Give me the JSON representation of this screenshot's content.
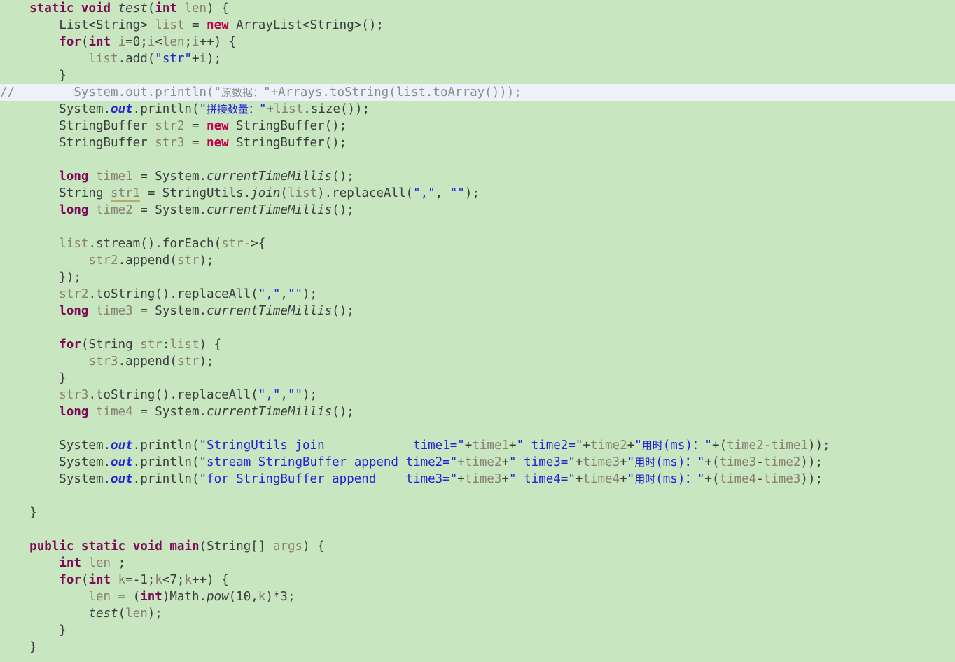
{
  "editor": {
    "language": "Java",
    "background_color": "#c8e6c0",
    "current_line_highlight_color": "#eef1fa",
    "keyword_color": "#7c0a56",
    "new_keyword_color": "#c3004d",
    "string_color": "#2323d6",
    "comment_color": "#7f938c",
    "variable_color": "#8a7f72",
    "warning_underline_color": "#b9a96a",
    "current_line_number": 6
  },
  "code": {
    "lines": [
      "    static void test(int len) {",
      "        List<String> list = new ArrayList<String>();",
      "        for(int i=0;i<len;i++) {",
      "            list.add(\"str\"+i);",
      "        }",
      "//        System.out.println(\"原数据：\"+Arrays.toString(list.toArray()));",
      "        System.out.println(\"拼接数量：\"+list.size());",
      "        StringBuffer str2 = new StringBuffer();",
      "        StringBuffer str3 = new StringBuffer();",
      "",
      "        long time1 = System.currentTimeMillis();",
      "        String str1 = StringUtils.join(list).replaceAll(\",\", \"\");",
      "        long time2 = System.currentTimeMillis();",
      "",
      "        list.stream().forEach(str->{",
      "            str2.append(str);",
      "        });",
      "        str2.toString().replaceAll(\",\",\"\");",
      "        long time3 = System.currentTimeMillis();",
      "",
      "        for(String str:list) {",
      "            str3.append(str);",
      "        }",
      "        str3.toString().replaceAll(\",\",\"\");",
      "        long time4 = System.currentTimeMillis();",
      "",
      "        System.out.println(\"StringUtils join            time1=\"+time1+\" time2=\"+time2+\"用时(ms)：\"+(time2-time1));",
      "        System.out.println(\"stream StringBuffer append time2=\"+time2+\" time3=\"+time3+\"用时(ms)：\"+(time3-time2));",
      "        System.out.println(\"for StringBuffer append    time3=\"+time3+\" time4=\"+time4+\"用时(ms)：\"+(time4-time3));",
      "",
      "    }",
      "",
      "    public static void main(String[] args) {",
      "        int len ;",
      "        for(int k=-1;k<7;k++) {",
      "            len = (int)Math.pow(10,k)*3;",
      "            test(len);",
      "        }",
      "    }"
    ],
    "tokens": {
      "l0": {
        "kw_static": "static",
        "kw_void": "void",
        "mth_test": "test",
        "kw_int": "int",
        "var_len": "len"
      },
      "l1_type": "List<String>",
      "l1_var": "list",
      "l1_new": "new",
      "l1_ctor": "ArrayList<String>();",
      "l3_str": "\"str\"",
      "l5_comment_cjk": "原数据：",
      "l6_string_cjk": "拼接数量：",
      "l11_unused_var": "str1",
      "cjk_used_time": "用时",
      "cjk_ms": "(ms)：",
      "label_join": "StringUtils join",
      "label_stream": "stream StringBuffer append",
      "label_for": "for StringBuffer append",
      "time_vars": [
        "time1",
        "time2",
        "time3",
        "time4"
      ],
      "pow_base": "10",
      "pow_mult": "3",
      "loop_start": "-1",
      "loop_end": "7"
    }
  }
}
